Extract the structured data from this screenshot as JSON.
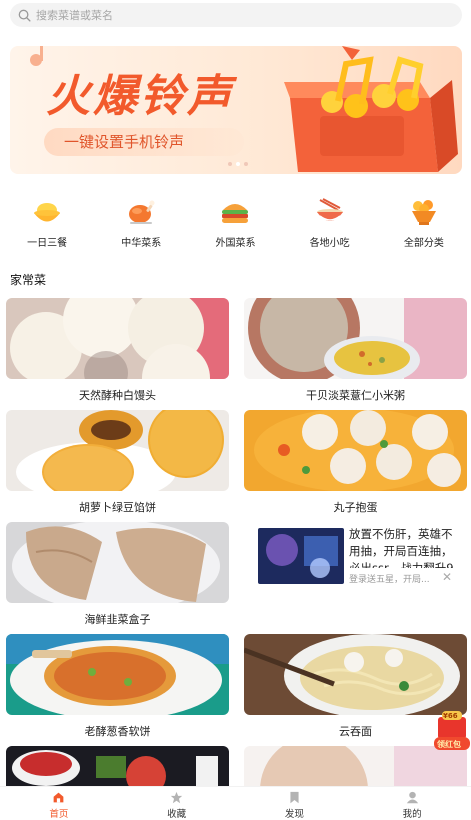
{
  "search": {
    "placeholder": "搜索菜谱或菜名"
  },
  "banner": {
    "title": "火爆铃声",
    "subtitle": "一键设置手机铃声"
  },
  "categories": [
    {
      "label": "一日三餐",
      "icon": "bowl-icon"
    },
    {
      "label": "中华菜系",
      "icon": "roast-chicken-icon"
    },
    {
      "label": "外国菜系",
      "icon": "burger-icon"
    },
    {
      "label": "各地小吃",
      "icon": "noodle-bowl-icon"
    },
    {
      "label": "全部分类",
      "icon": "food-bowl-icon"
    }
  ],
  "section": {
    "title": "家常菜"
  },
  "recipes": [
    {
      "title": "天然酵种白馒头"
    },
    {
      "title": "干贝淡菜薏仁小米粥"
    },
    {
      "title": "胡萝卜绿豆馅饼"
    },
    {
      "title": "丸子抱蛋"
    },
    {
      "title": "海鲜韭菜盒子"
    },
    {
      "title": "老酵葱香软饼"
    },
    {
      "title": "云吞面"
    }
  ],
  "ad": {
    "text": "放置不伤肝，英雄不用抽，开局百连抽，必出ssr，战力翻升9",
    "sub": "登录送五星，开局...",
    "close": "✕"
  },
  "redpack": {
    "badge": "¥66",
    "label": "领红包"
  },
  "tabs": [
    {
      "label": "首页",
      "icon": "home-icon",
      "active": true
    },
    {
      "label": "收藏",
      "icon": "star-icon",
      "active": false
    },
    {
      "label": "发现",
      "icon": "bookmark-icon",
      "active": false
    },
    {
      "label": "我的",
      "icon": "user-icon",
      "active": false
    }
  ],
  "colors": {
    "accent": "#f25a2c",
    "inactive_icon": "#b3b3b3"
  }
}
